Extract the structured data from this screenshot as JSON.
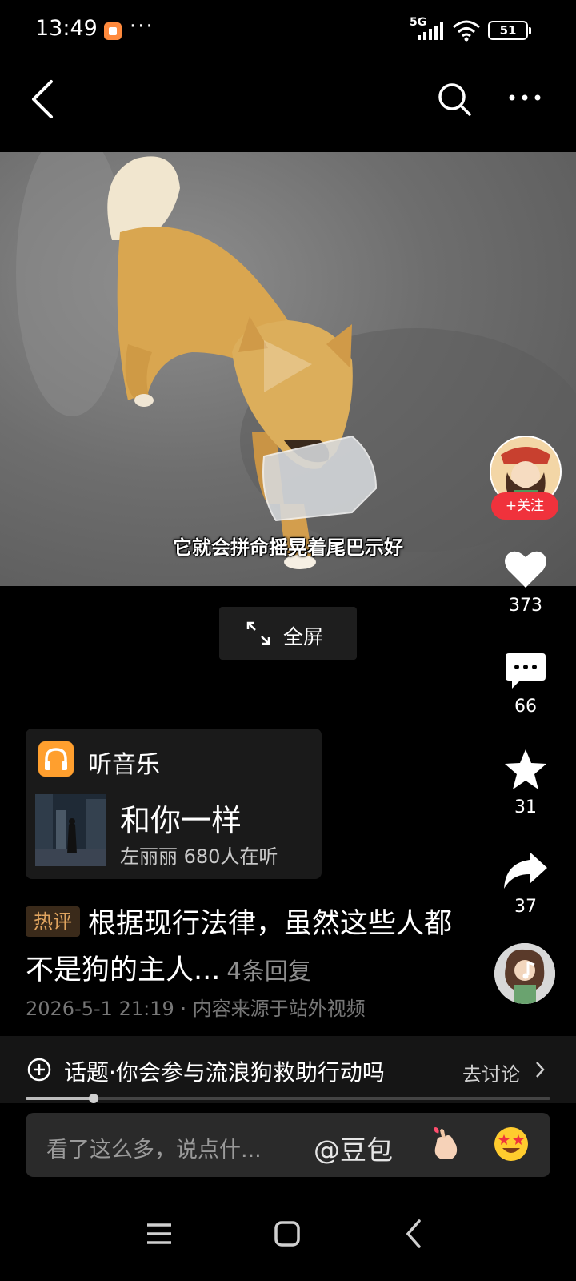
{
  "status_bar": {
    "time": "13:49",
    "dots": "···",
    "network": "5G",
    "battery": "51"
  },
  "top_nav": {
    "back": "back-icon",
    "search": "search-icon",
    "more": "more-icon"
  },
  "video": {
    "subtitle": "它就会拼命摇晃着尾巴示好"
  },
  "fullscreen": {
    "label": "全屏"
  },
  "creator": {
    "follow_label": "+关注"
  },
  "actions": {
    "likes": "373",
    "comments": "66",
    "favorites": "31",
    "shares": "37"
  },
  "music_card": {
    "heading": "听音乐",
    "song": "和你一样",
    "meta": "左丽丽 680人在听"
  },
  "hot_comment": {
    "badge": "热评",
    "text": "根据现行法律，虽然这些人都不是狗的主人...",
    "replies": "4条回复"
  },
  "post_meta": "2026-5-1 21:19 · 内容来源于站外视频",
  "topic": {
    "text": "话题·你会参与流浪狗救助行动吗",
    "action": "去讨论"
  },
  "progress": {
    "fraction": 0.13
  },
  "comment_input": {
    "placeholder": "看了这么多，说点什...",
    "mention": "@豆包"
  },
  "colors": {
    "follow": "#f0323c",
    "music_icon": "#ff9f2e",
    "hot_badge_text": "#e0a45f"
  }
}
